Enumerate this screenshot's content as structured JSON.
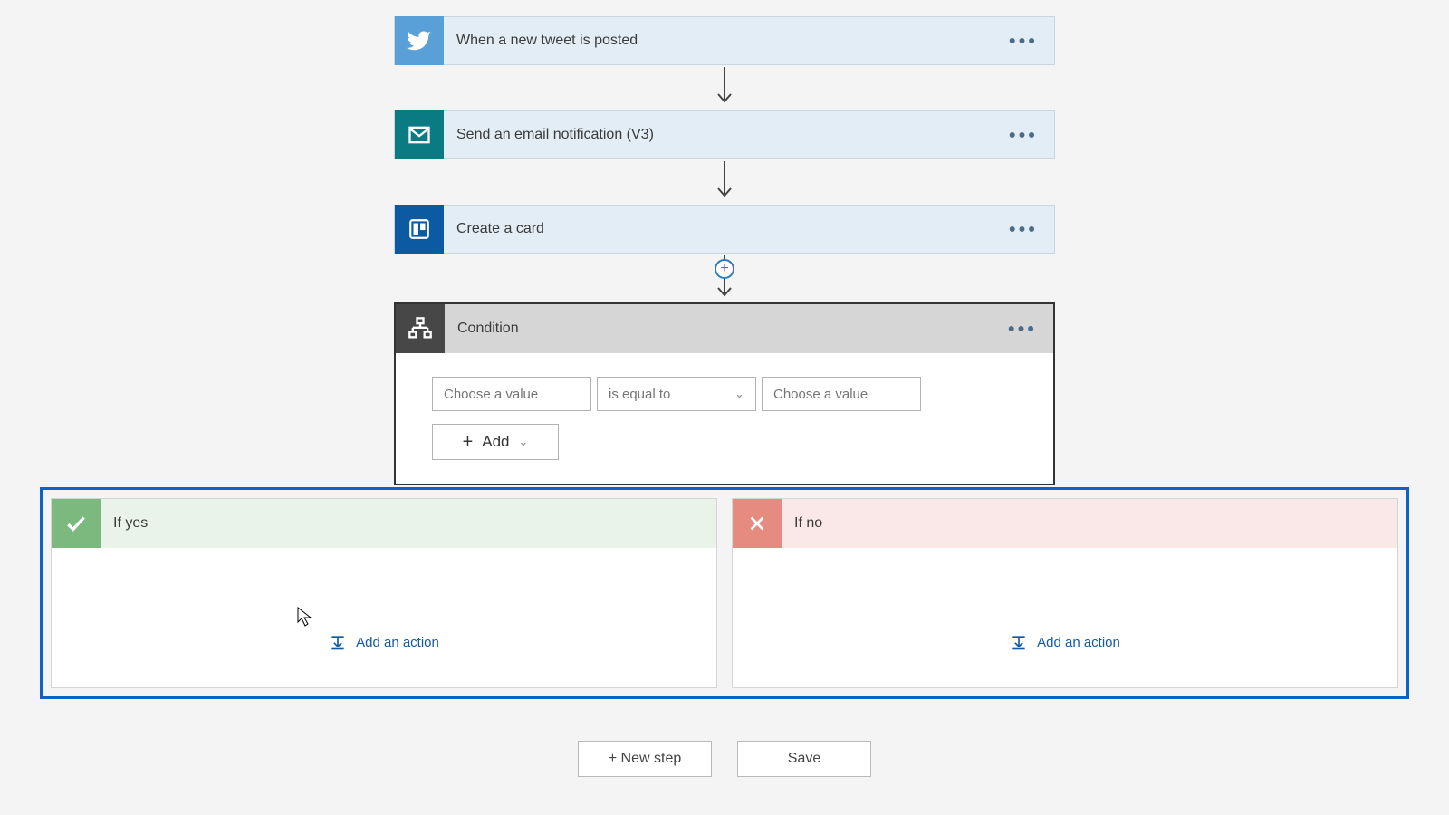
{
  "steps": {
    "twitter": {
      "title": "When a new tweet is posted"
    },
    "email": {
      "title": "Send an email notification (V3)"
    },
    "trello": {
      "title": "Create a card"
    }
  },
  "condition": {
    "title": "Condition",
    "left_placeholder": "Choose a value",
    "operator": "is equal to",
    "right_placeholder": "Choose a value",
    "add_label": "Add"
  },
  "branches": {
    "yes_label": "If yes",
    "no_label": "If no",
    "add_action_label": "Add an action"
  },
  "footer": {
    "new_step": "+ New step",
    "save": "Save"
  }
}
